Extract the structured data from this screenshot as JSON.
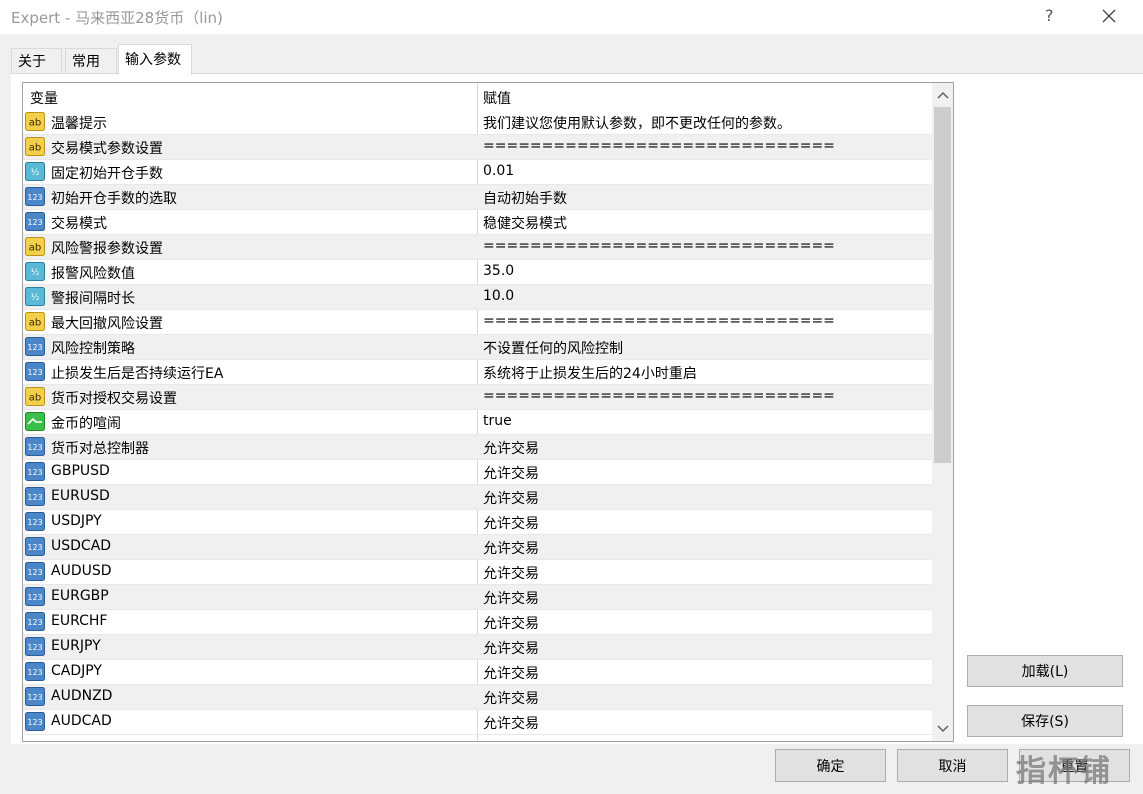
{
  "window": {
    "title": "Expert - 马来西亚28货币（lin)",
    "help": "?"
  },
  "tabs": [
    {
      "label": "关于",
      "active": false
    },
    {
      "label": "常用",
      "active": false
    },
    {
      "label": "输入参数",
      "active": true
    }
  ],
  "grid": {
    "headers": {
      "variable": "变量",
      "value": "赋值"
    },
    "rows": [
      {
        "icon": "ab",
        "name": "温馨提示",
        "value": "我们建议您使用默认参数，即不更改任何的参数。"
      },
      {
        "icon": "ab",
        "name": "交易模式参数设置",
        "value": "=============================="
      },
      {
        "icon": "half",
        "name": "固定初始开仓手数",
        "value": "0.01"
      },
      {
        "icon": "123",
        "name": "初始开仓手数的选取",
        "value": "自动初始手数"
      },
      {
        "icon": "123",
        "name": "交易模式",
        "value": "稳健交易模式"
      },
      {
        "icon": "ab",
        "name": "风险警报参数设置",
        "value": "=============================="
      },
      {
        "icon": "half",
        "name": "报警风险数值",
        "value": "35.0"
      },
      {
        "icon": "half",
        "name": "警报间隔时长",
        "value": "10.0"
      },
      {
        "icon": "ab",
        "name": "最大回撤风险设置",
        "value": "=============================="
      },
      {
        "icon": "123",
        "name": "风险控制策略",
        "value": "不设置任何的风险控制"
      },
      {
        "icon": "123",
        "name": "止损发生后是否持续运行EA",
        "value": "系统将于止损发生后的24小时重启"
      },
      {
        "icon": "ab",
        "name": "货币对授权交易设置",
        "value": "=============================="
      },
      {
        "icon": "bool",
        "name": "金币的喧闹",
        "value": "true"
      },
      {
        "icon": "123",
        "name": "货币对总控制器",
        "value": "允许交易"
      },
      {
        "icon": "123",
        "name": "GBPUSD",
        "value": "允许交易"
      },
      {
        "icon": "123",
        "name": "EURUSD",
        "value": "允许交易"
      },
      {
        "icon": "123",
        "name": "USDJPY",
        "value": "允许交易"
      },
      {
        "icon": "123",
        "name": "USDCAD",
        "value": "允许交易"
      },
      {
        "icon": "123",
        "name": "AUDUSD",
        "value": "允许交易"
      },
      {
        "icon": "123",
        "name": "EURGBP",
        "value": "允许交易"
      },
      {
        "icon": "123",
        "name": "EURCHF",
        "value": "允许交易"
      },
      {
        "icon": "123",
        "name": "EURJPY",
        "value": "允许交易"
      },
      {
        "icon": "123",
        "name": "CADJPY",
        "value": "允许交易"
      },
      {
        "icon": "123",
        "name": "AUDNZD",
        "value": "允许交易"
      },
      {
        "icon": "123",
        "name": "AUDCAD",
        "value": "允许交易"
      }
    ]
  },
  "buttons": {
    "load": "加载(L)",
    "save": "保存(S)",
    "ok": "确定",
    "cancel": "取消",
    "reset": "重置"
  },
  "watermark": "指杯铺",
  "colors": {
    "ab_icon": "#f2d04b",
    "num_icon": "#4a86c8",
    "half_icon": "#5bb8d6",
    "bool_icon": "#3bbf4a"
  }
}
